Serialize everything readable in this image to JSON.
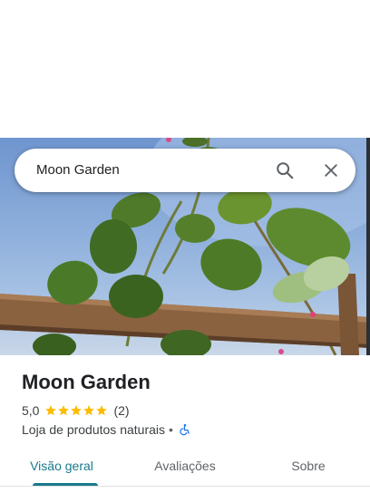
{
  "search": {
    "query": "Moon Garden"
  },
  "place": {
    "name": "Moon Garden",
    "rating": "5,0",
    "stars_filled": 5,
    "stars_total": 5,
    "review_count": "(2)",
    "category": "Loja de produtos naturais",
    "separator": "•",
    "accessibility_icon": "wheelchair-icon"
  },
  "tabs": [
    {
      "label": "Visão geral",
      "active": true
    },
    {
      "label": "Avaliações",
      "active": false
    },
    {
      "label": "Sobre",
      "active": false
    }
  ],
  "colors": {
    "accent": "#1a7a8c",
    "star": "#fbbc04",
    "accessibility": "#1a73e8"
  }
}
